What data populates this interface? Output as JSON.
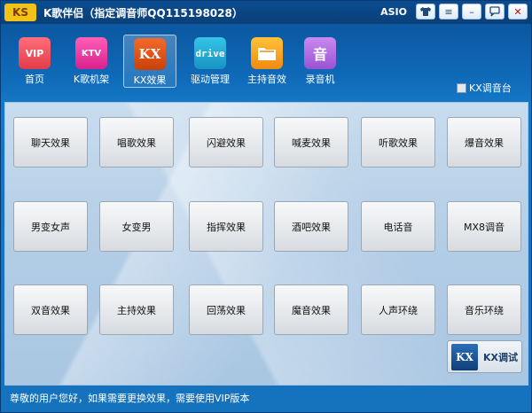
{
  "window": {
    "logo_text": "KS",
    "title": "K歌伴侣（指定调音师QQ115198028）",
    "asio_label": "ASIO",
    "controls": {
      "shirt_icon": "shirt-icon",
      "menu": "≡",
      "minimize": "–",
      "chat": "💬",
      "close": "✕"
    }
  },
  "toolbar": {
    "items": [
      {
        "icon_text": "VIP",
        "label": "首页",
        "icon": "vip-crown-icon",
        "color": "#e23c4c"
      },
      {
        "icon_text": "KTV",
        "label": "K歌机架",
        "icon": "ktv-microphone-icon",
        "color": "#d9218f"
      },
      {
        "icon_text": "KX",
        "label": "KX效果",
        "icon": "kx-icon",
        "color": "#c9400a"
      },
      {
        "icon_text": "drive",
        "label": "驱动管理",
        "icon": "drive-icon",
        "color": "#1794c2"
      },
      {
        "icon_text": "",
        "label": "主持音效",
        "icon": "folder-icon",
        "color": "#f08a10"
      },
      {
        "icon_text": "音",
        "label": "录音机",
        "icon": "recorder-icon",
        "color": "#9a52d4"
      }
    ],
    "active_index": 2
  },
  "tune_checkbox": {
    "label": "KX调音台",
    "checked": false
  },
  "effects": {
    "rows": [
      [
        "聊天效果",
        "唱歌效果",
        "闪避效果",
        "喊麦效果",
        "听歌效果",
        "爆音效果"
      ],
      [
        "男变女声",
        "女变男",
        "指挥效果",
        "酒吧效果",
        "电话音",
        "MX8调音"
      ],
      [
        "双音效果",
        "主持效果",
        "回荡效果",
        "魔音效果",
        "人声环绕",
        "音乐环绕"
      ]
    ]
  },
  "debug_button": {
    "icon_text": "KX",
    "label": "KX调试"
  },
  "status": {
    "text": "尊敬的用户您好，如果需要更换效果，需要使用VIP版本"
  }
}
